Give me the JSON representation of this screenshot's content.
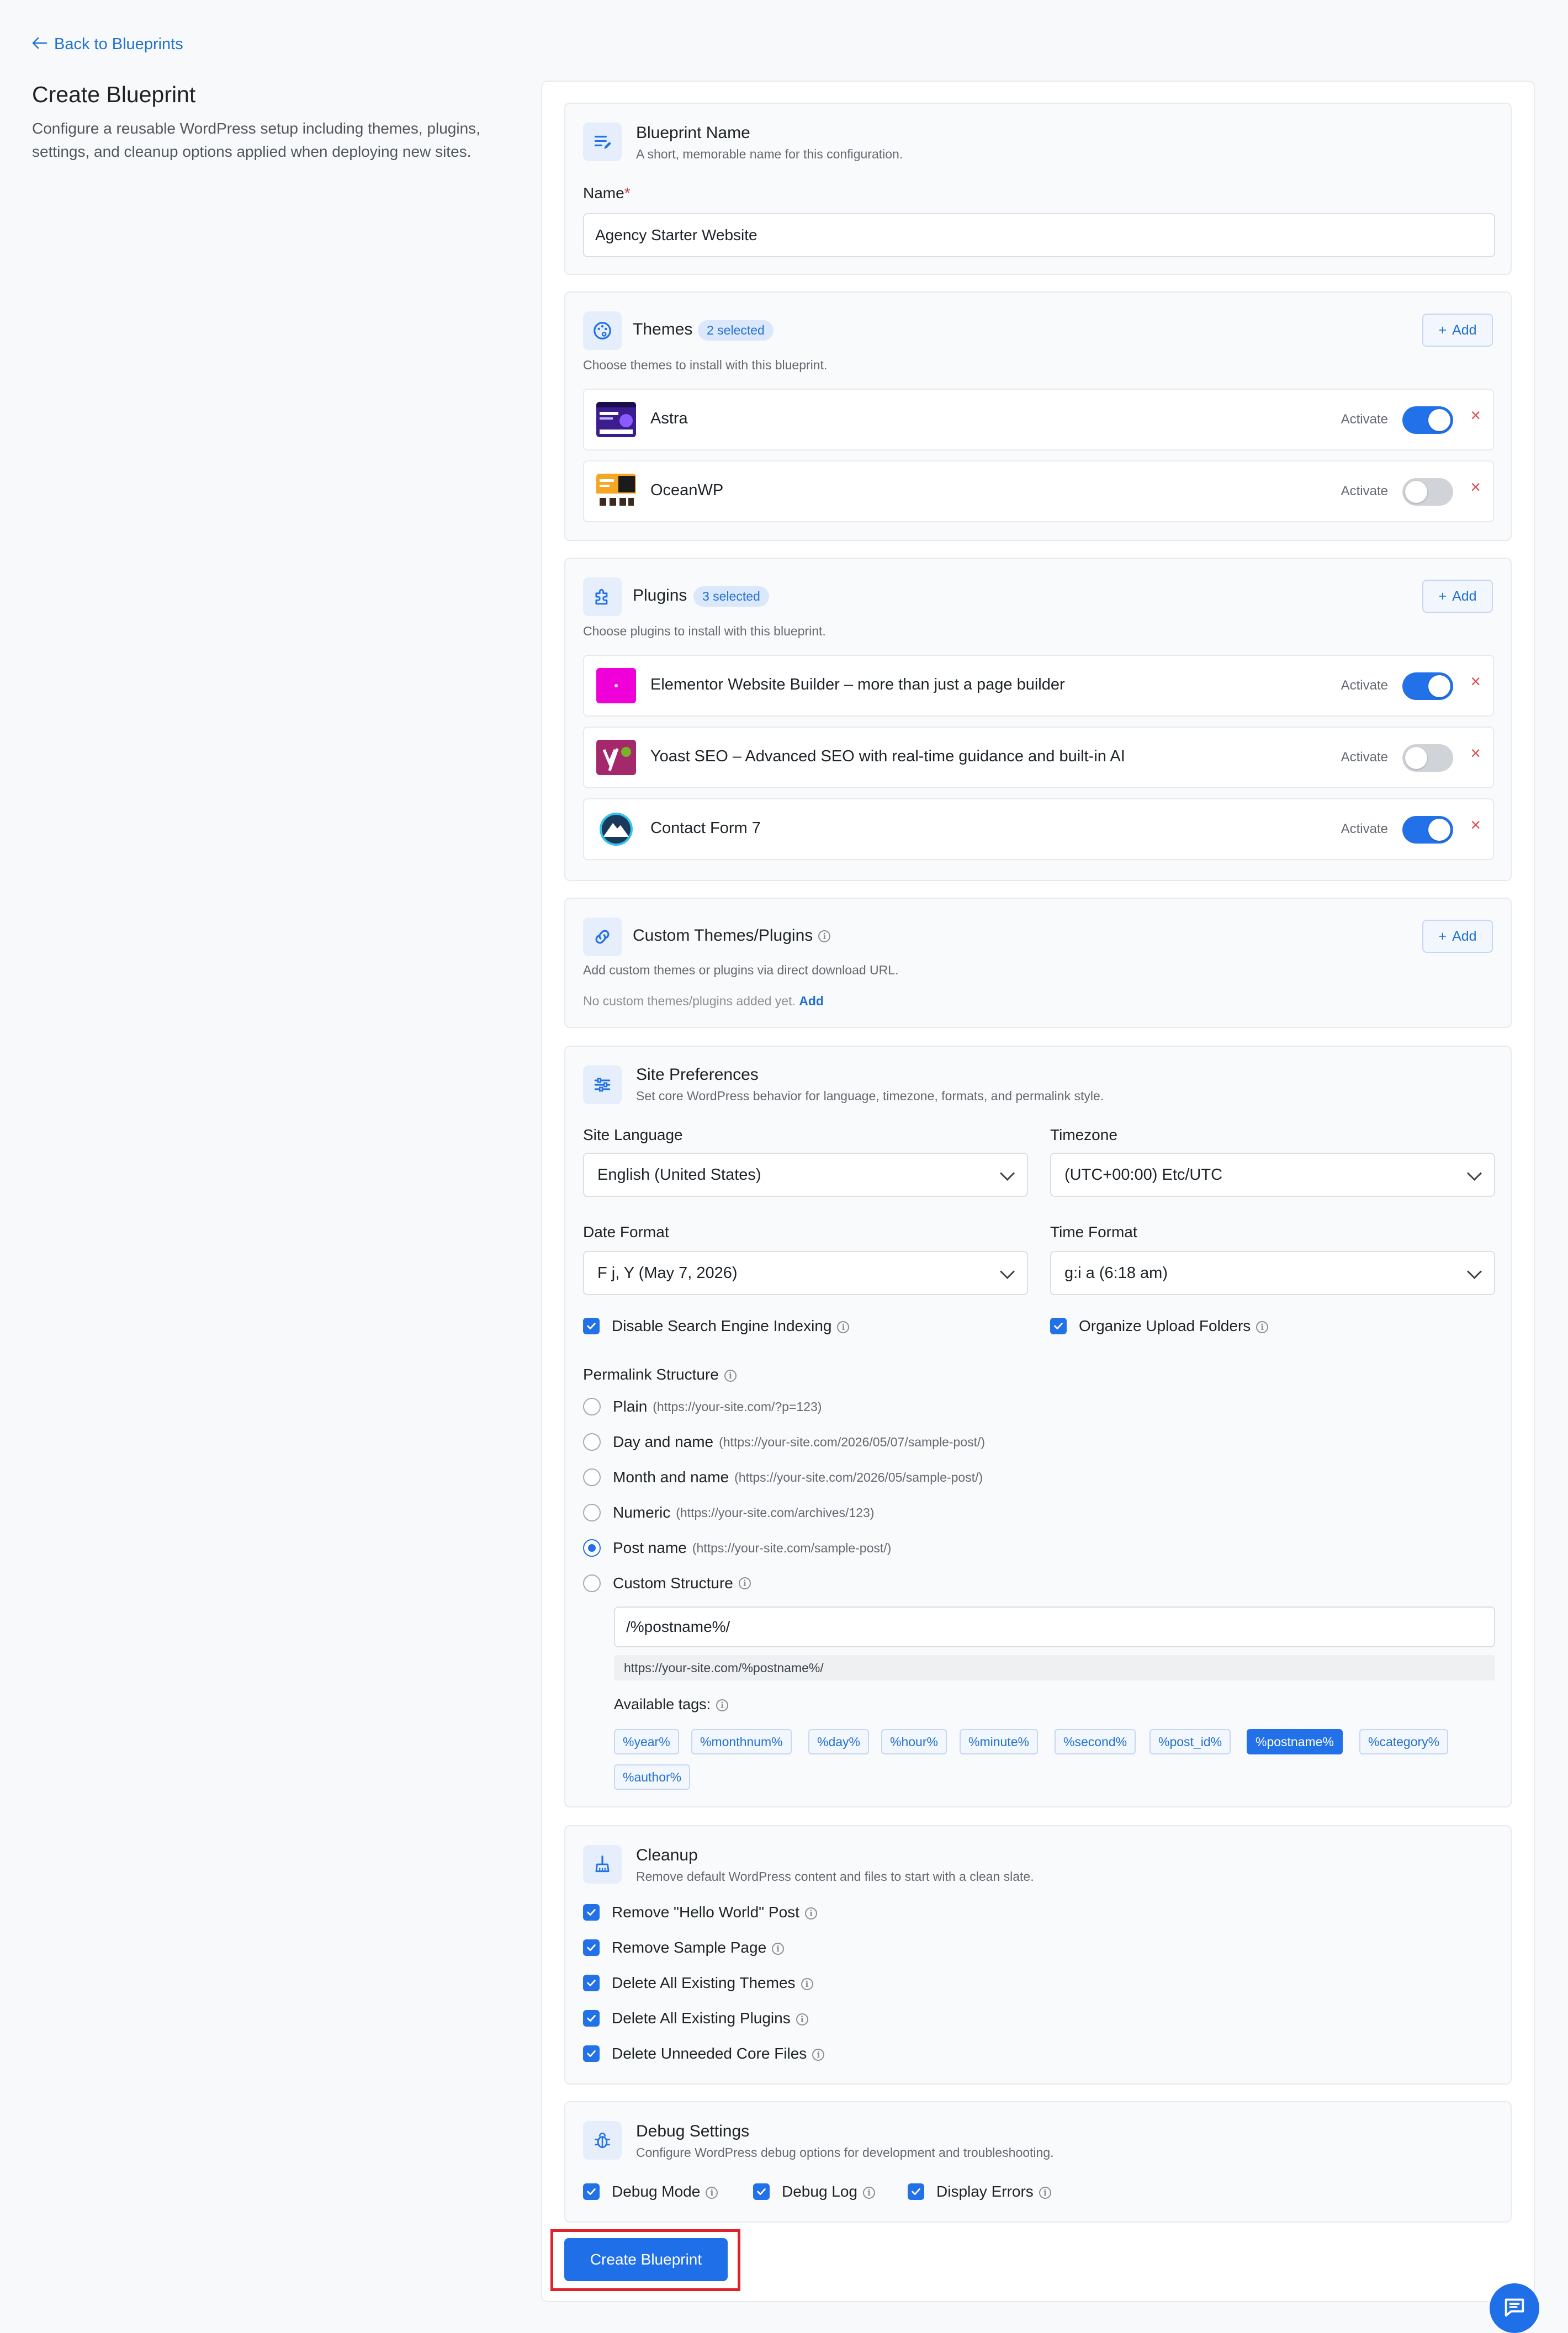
{
  "nav": {
    "back_label": "Back to Blueprints"
  },
  "header": {
    "title": "Create Blueprint",
    "description": "Configure a reusable WordPress setup including themes, plugins, settings, and cleanup options applied when deploying new sites."
  },
  "blueprint_name": {
    "title": "Blueprint Name",
    "subtitle": "A short, memorable name for this configuration.",
    "field_label": "Name",
    "required_mark": "*",
    "value": "Agency Starter Website"
  },
  "themes": {
    "title": "Themes",
    "badge": "2 selected",
    "subtitle": "Choose themes to install with this blueprint.",
    "add_label": "Add",
    "items": [
      {
        "name": "Astra",
        "activate_label": "Activate",
        "active": true
      },
      {
        "name": "OceanWP",
        "activate_label": "Activate",
        "active": false
      }
    ]
  },
  "plugins": {
    "title": "Plugins",
    "badge": "3 selected",
    "subtitle": "Choose plugins to install with this blueprint.",
    "add_label": "Add",
    "items": [
      {
        "name": "Elementor Website Builder – more than just a page builder",
        "activate_label": "Activate",
        "active": true
      },
      {
        "name": "Yoast SEO – Advanced SEO with real-time guidance and built-in AI",
        "activate_label": "Activate",
        "active": false
      },
      {
        "name": "Contact Form 7",
        "activate_label": "Activate",
        "active": true
      }
    ]
  },
  "custom": {
    "title": "Custom Themes/Plugins",
    "subtitle": "Add custom themes or plugins via direct download URL.",
    "empty_text": "No custom themes/plugins added yet.",
    "empty_link": "Add",
    "add_label": "Add"
  },
  "site_prefs": {
    "title": "Site Preferences",
    "subtitle": "Set core WordPress behavior for language, timezone, formats, and permalink style.",
    "language": {
      "label": "Site Language",
      "value": "English (United States)"
    },
    "timezone": {
      "label": "Timezone",
      "value": "(UTC+00:00) Etc/UTC"
    },
    "date_format": {
      "label": "Date Format",
      "value": "F j, Y (May 7, 2026)"
    },
    "time_format": {
      "label": "Time Format",
      "value": "g:i a (6:18 am)"
    },
    "disable_indexing": {
      "label": "Disable Search Engine Indexing",
      "checked": true
    },
    "organize_uploads": {
      "label": "Organize Upload Folders",
      "checked": true
    },
    "permalink": {
      "label": "Permalink Structure",
      "options": [
        {
          "label": "Plain",
          "hint": "(https://your-site.com/?p=123)",
          "selected": false
        },
        {
          "label": "Day and name",
          "hint": "(https://your-site.com/2026/05/07/sample-post/)",
          "selected": false
        },
        {
          "label": "Month and name",
          "hint": "(https://your-site.com/2026/05/sample-post/)",
          "selected": false
        },
        {
          "label": "Numeric",
          "hint": "(https://your-site.com/archives/123)",
          "selected": false
        },
        {
          "label": "Post name",
          "hint": "(https://your-site.com/sample-post/)",
          "selected": true
        },
        {
          "label": "Custom Structure",
          "hint": "",
          "selected": false
        }
      ],
      "custom_value": "/%postname%/",
      "preview": "https://your-site.com/%postname%/",
      "tags_label": "Available tags:",
      "tags": [
        "%year%",
        "%monthnum%",
        "%day%",
        "%hour%",
        "%minute%",
        "%second%",
        "%post_id%",
        "%postname%",
        "%category%",
        "%author%"
      ],
      "selected_tag": "%postname%"
    }
  },
  "cleanup": {
    "title": "Cleanup",
    "subtitle": "Remove default WordPress content and files to start with a clean slate.",
    "items": [
      {
        "label": "Remove \"Hello World\" Post",
        "checked": true
      },
      {
        "label": "Remove Sample Page",
        "checked": true
      },
      {
        "label": "Delete All Existing Themes",
        "checked": true
      },
      {
        "label": "Delete All Existing Plugins",
        "checked": true
      },
      {
        "label": "Delete Unneeded Core Files",
        "checked": true
      }
    ]
  },
  "debug": {
    "title": "Debug Settings",
    "subtitle": "Configure WordPress debug options for development and troubleshooting.",
    "items": [
      {
        "label": "Debug Mode",
        "checked": true
      },
      {
        "label": "Debug Log",
        "checked": true
      },
      {
        "label": "Display Errors",
        "checked": true
      }
    ]
  },
  "actions": {
    "create_label": "Create Blueprint"
  },
  "colors": {
    "accent": "#2271e8",
    "danger": "#e24b4b",
    "highlight": "#e0222a"
  }
}
